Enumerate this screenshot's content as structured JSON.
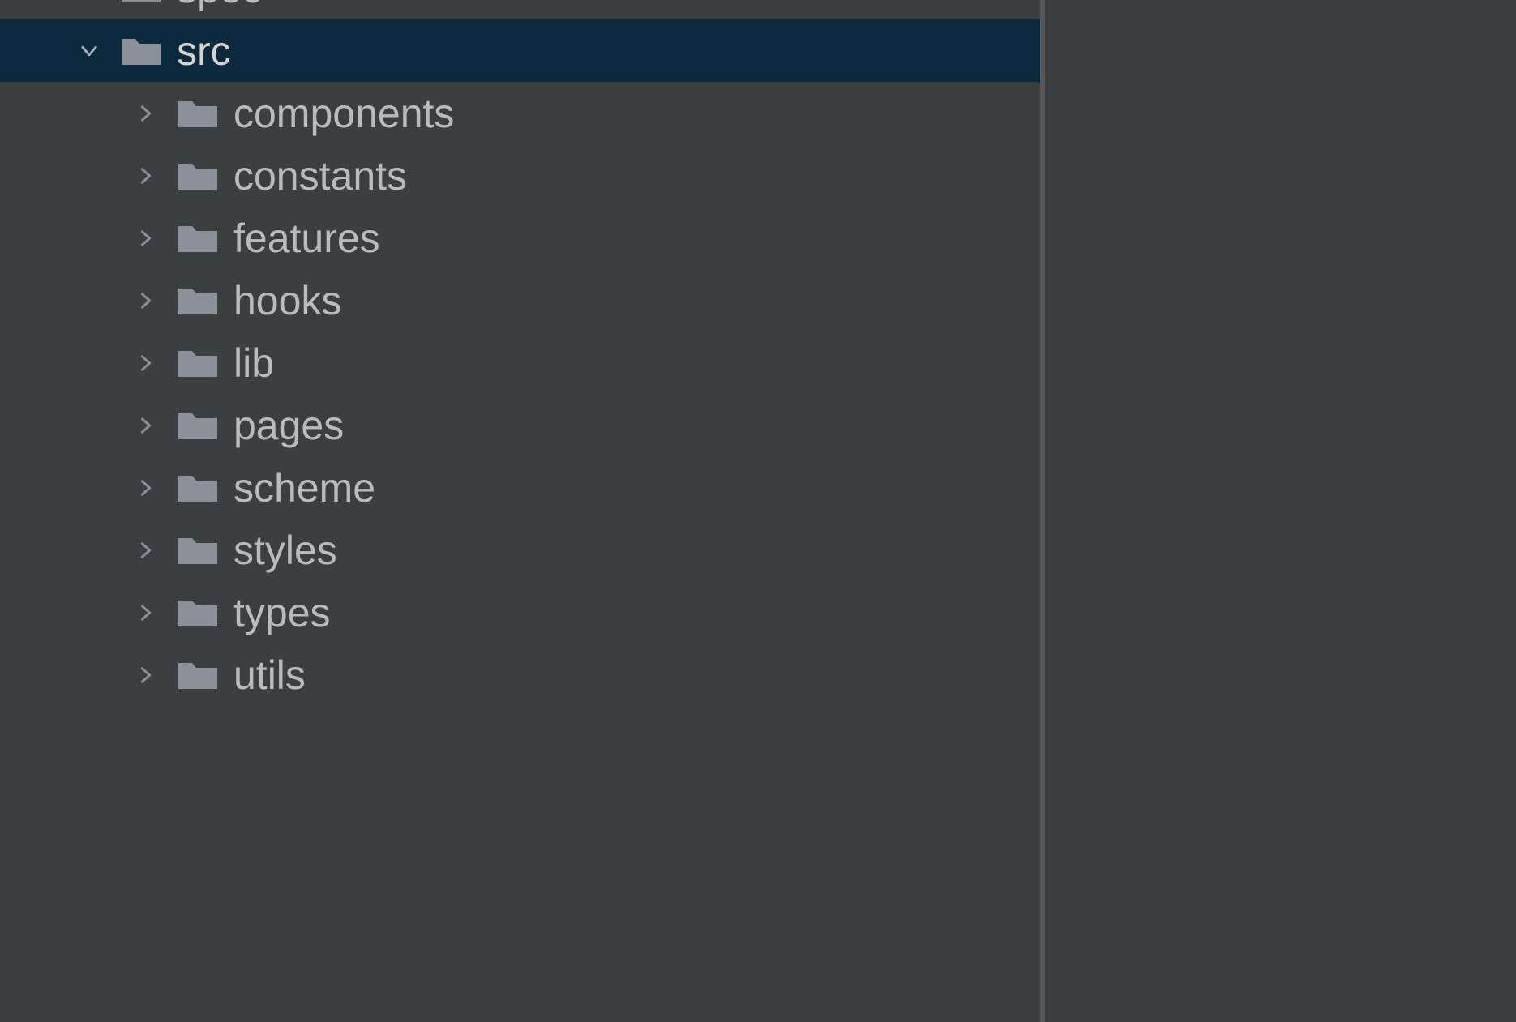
{
  "tree": {
    "partial_top": {
      "label": "spec",
      "expanded": false
    },
    "root": {
      "label": "src",
      "expanded": true,
      "selected": true
    },
    "children": [
      {
        "label": "components",
        "expanded": false
      },
      {
        "label": "constants",
        "expanded": false
      },
      {
        "label": "features",
        "expanded": false
      },
      {
        "label": "hooks",
        "expanded": false
      },
      {
        "label": "lib",
        "expanded": false
      },
      {
        "label": "pages",
        "expanded": false
      },
      {
        "label": "scheme",
        "expanded": false
      },
      {
        "label": "styles",
        "expanded": false
      },
      {
        "label": "types",
        "expanded": false
      },
      {
        "label": "utils",
        "expanded": false
      }
    ]
  },
  "colors": {
    "background": "#3c3f41",
    "selected_background": "#0d293e",
    "text": "#bbbbbb",
    "icon": "#8a9199",
    "icon_selected": "#a6b0ba"
  }
}
